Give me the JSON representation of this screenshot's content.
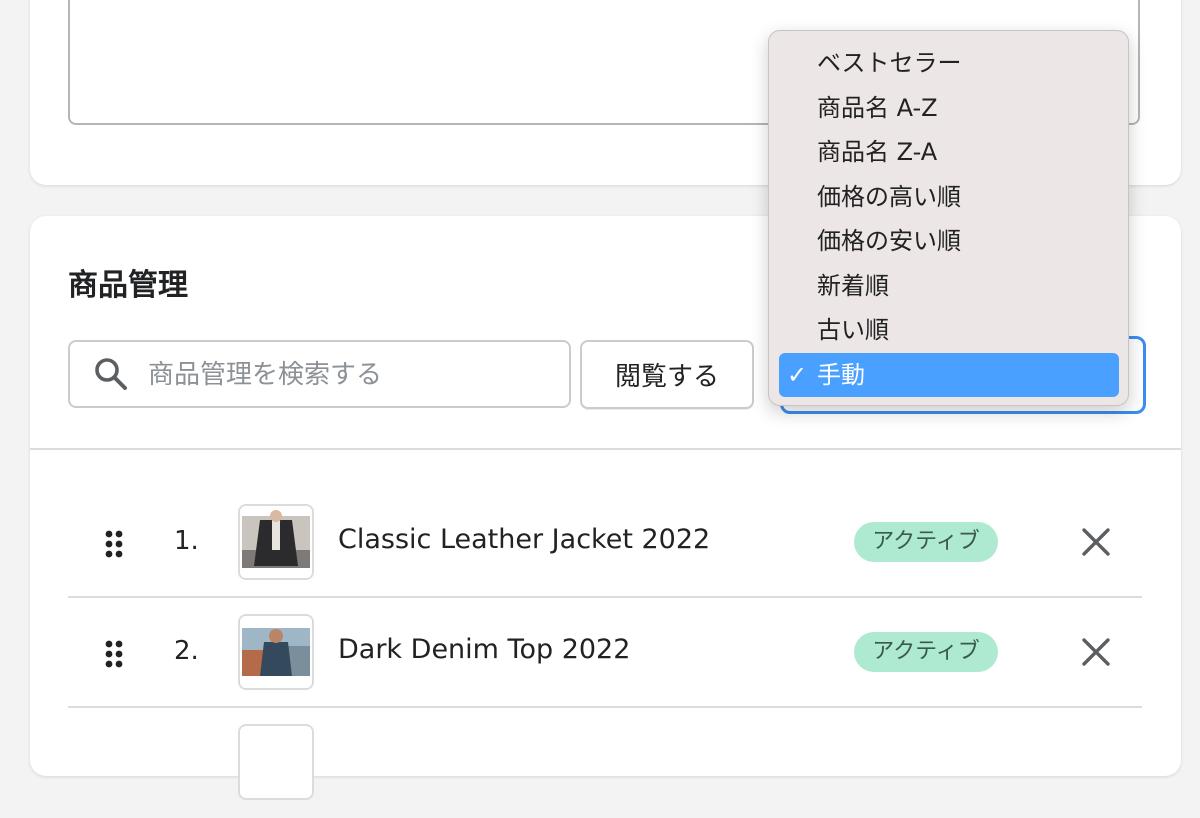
{
  "section": {
    "title": "商品管理"
  },
  "search": {
    "placeholder": "商品管理を検索する",
    "value": ""
  },
  "browse_button": {
    "label": "閲覧する"
  },
  "sort_dropdown": {
    "options": [
      {
        "label": "ベストセラー",
        "selected": false
      },
      {
        "label": "商品名 A-Z",
        "selected": false
      },
      {
        "label": "商品名 Z-A",
        "selected": false
      },
      {
        "label": "価格の高い順",
        "selected": false
      },
      {
        "label": "価格の安い順",
        "selected": false
      },
      {
        "label": "新着順",
        "selected": false
      },
      {
        "label": "古い順",
        "selected": false
      },
      {
        "label": "手動",
        "selected": true
      }
    ],
    "check_mark": "✓"
  },
  "products": [
    {
      "index": "1.",
      "name": "Classic Leather Jacket 2022",
      "status": "アクティブ",
      "thumb_icon": "leather-jacket-image"
    },
    {
      "index": "2.",
      "name": "Dark Denim Top 2022",
      "status": "アクティブ",
      "thumb_icon": "denim-top-image"
    }
  ],
  "colors": {
    "accent": "#3b8df0",
    "selected_option": "#4aa0ff",
    "badge_bg": "#aee9d1",
    "badge_text": "#3a5a4c",
    "dropdown_bg": "#ece6e7"
  }
}
